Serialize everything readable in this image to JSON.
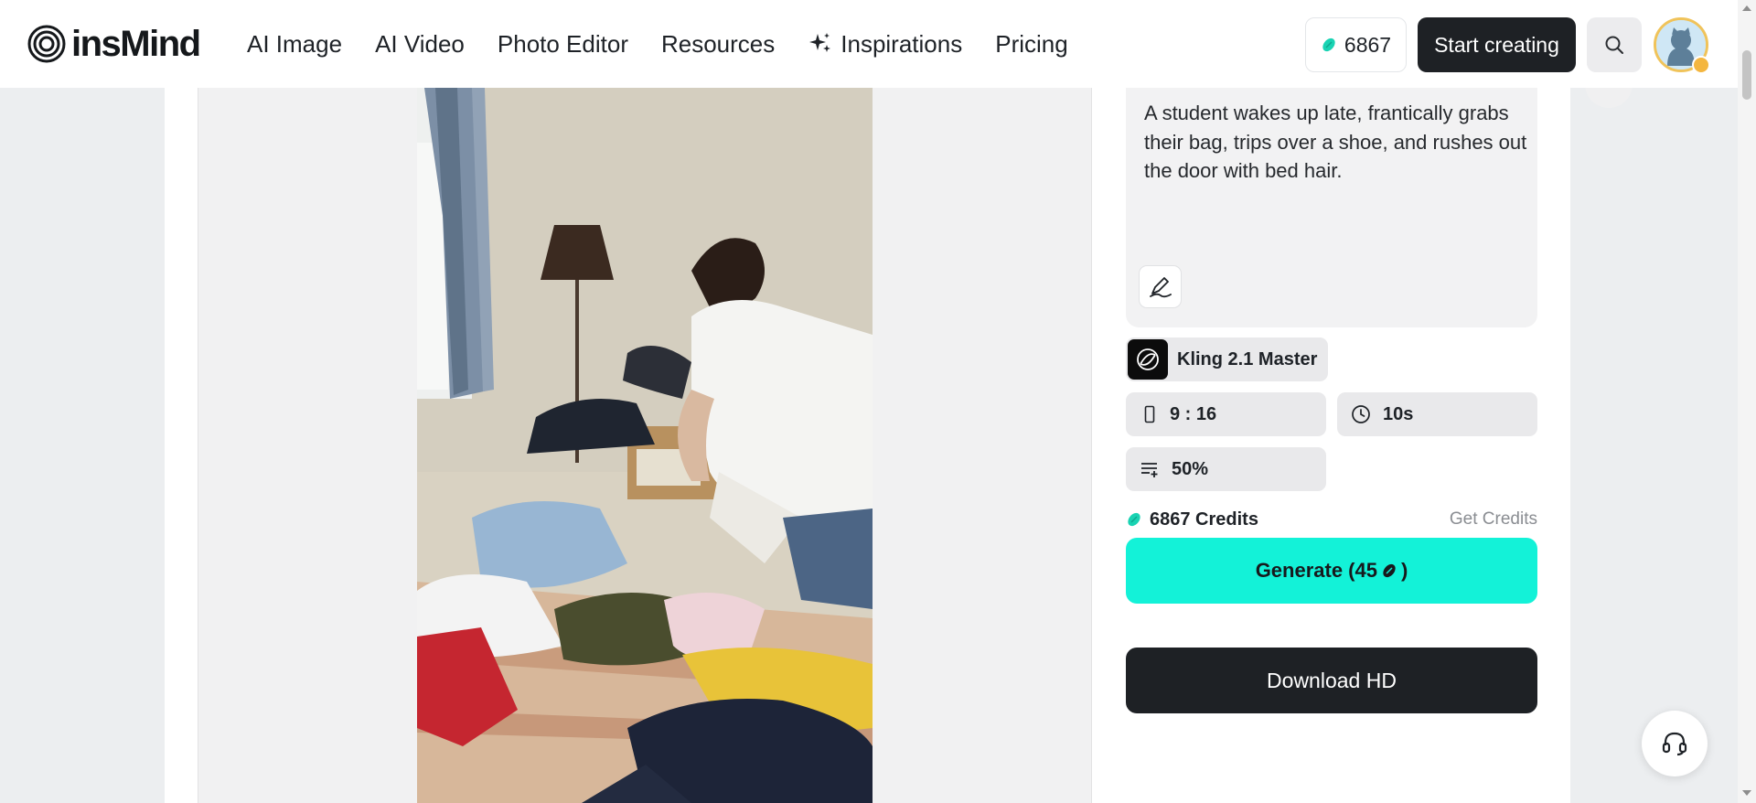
{
  "header": {
    "logo_text": "insMind",
    "nav": [
      {
        "label": "AI Image"
      },
      {
        "label": "AI Video"
      },
      {
        "label": "Photo Editor"
      },
      {
        "label": "Resources"
      },
      {
        "label": "Inspirations",
        "icon": "sparkle-icon"
      },
      {
        "label": "Pricing"
      }
    ],
    "credits": "6867",
    "start_label": "Start creating"
  },
  "prompt": {
    "text": "A student wakes up late, frantically grabs their bag, trips over a shoe, and rushes out the door with bed hair."
  },
  "settings": {
    "model": "Kling 2.1 Master",
    "ratio": "9 : 16",
    "duration": "10s",
    "strength": "50%"
  },
  "credits_row": {
    "balance": "6867 Credits",
    "get_credits": "Get Credits"
  },
  "actions": {
    "generate_label": "Generate (45",
    "generate_suffix": ")",
    "download_label": "Download HD"
  },
  "colors": {
    "accent": "#13f2d8",
    "dark_button": "#1e2125",
    "credit_icon": "#19d3b3",
    "avatar_ring": "#f0c35a"
  }
}
